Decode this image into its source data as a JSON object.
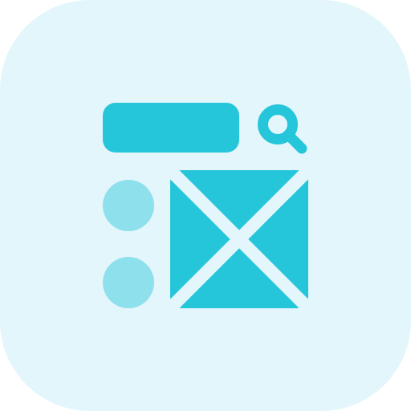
{
  "icon": {
    "name": "search-layout-icon",
    "colors": {
      "background": "#E3F6FB",
      "primary": "#26C6DA",
      "secondary": "#8EE0EC",
      "cutout": "#E3F6FB"
    },
    "parts": [
      "search-bar-placeholder",
      "magnifier-icon",
      "list-dot-top",
      "list-dot-bottom",
      "image-placeholder"
    ]
  }
}
